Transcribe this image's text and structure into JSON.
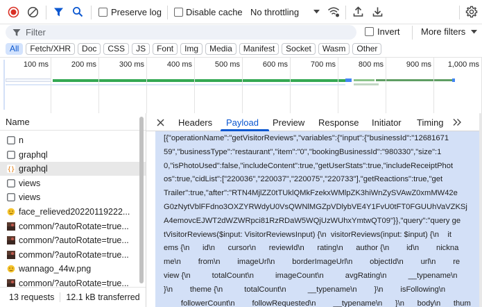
{
  "toolbar": {
    "preserve_log": "Preserve log",
    "disable_cache": "Disable cache",
    "throttling": "No throttling"
  },
  "filter": {
    "placeholder": "Filter",
    "invert": "Invert",
    "more_filters": "More filters"
  },
  "type_filters": [
    "All",
    "Fetch/XHR",
    "Doc",
    "CSS",
    "JS",
    "Font",
    "Img",
    "Media",
    "Manifest",
    "Socket",
    "Wasm",
    "Other"
  ],
  "timeline": {
    "ticks": [
      "100 ms",
      "200 ms",
      "300 ms",
      "400 ms",
      "500 ms",
      "600 ms",
      "700 ms",
      "800 ms",
      "900 ms",
      "1,000 ms"
    ]
  },
  "requests": {
    "header": "Name",
    "rows": [
      {
        "name": "n",
        "icon": "document-icon"
      },
      {
        "name": "graphql",
        "icon": "document-icon"
      },
      {
        "name": "graphql",
        "icon": "fetch-xhr-icon",
        "selected": true
      },
      {
        "name": "views",
        "icon": "document-icon"
      },
      {
        "name": "views",
        "icon": "document-icon"
      },
      {
        "name": "face_relieved20220119222...",
        "icon": "emoji-image-icon"
      },
      {
        "name": "common/?autoRotate=true...",
        "icon": "thumbnail-image-icon"
      },
      {
        "name": "common/?autoRotate=true...",
        "icon": "thumbnail-image-icon"
      },
      {
        "name": "common/?autoRotate=true...",
        "icon": "thumbnail-image-icon"
      },
      {
        "name": "wannago_44w.png",
        "icon": "emoji-image-icon"
      },
      {
        "name": "common/?autoRotate=true...",
        "icon": "thumbnail-image-icon"
      }
    ],
    "summary_requests": "13 requests",
    "summary_transferred": "12.1 kB transferred"
  },
  "details": {
    "tabs": [
      "Headers",
      "Payload",
      "Preview",
      "Response",
      "Initiator",
      "Timing"
    ],
    "active_tab": "Payload",
    "payload_lines": [
      "[{\"operationName\":\"getVisitorReviews\",\"variables\":{\"input\":{\"businessId\":\"12681671",
      "59\",\"businessType\":\"restaurant\",\"item\":\"0\",\"bookingBusinessId\":\"980330\",\"size\":1",
      "0,\"isPhotoUsed\":false,\"includeContent\":true,\"getUserStats\":true,\"includeReceiptPhot",
      "os\":true,\"cidList\":[\"220036\",\"220037\",\"220075\",\"220733\"],\"getReactions\":true,\"get",
      "Trailer\":true,\"after\":\"RTN4MjlZZ0tTUklQMkFzekxWMlpZK3hiWnZySVAwZ0xmMW42e",
      "G0zNytVblFFdno3OXZYRWdyU0VsQWNlMGZpVDlybVE4Y1FvU0tFT0FGUUhVaVZKSj",
      "A4emovcEJWT2dWZWRpci81RzRDaW5WQjUzWUhxYmtwQT09\"}},\"query\":\"query ge",
      "tVisitorReviews($input: VisitorReviewsInput) {\\n  visitorReviews(input: $input) {\\n    it",
      "ems {\\n      id\\n      cursor\\n      reviewId\\n      rating\\n      author {\\n        id\\n        nickna",
      "me\\n        from\\n        imageUrl\\n        borderImageUrl\\n        objectId\\n        url\\n        re",
      "view {\\n          totalCount\\n          imageCount\\n          avgRating\\n          __typename\\n",
      "}\\n        theme {\\n          totalCount\\n          __typename\\n        }\\n        isFollowing\\n",
      "        followerCount\\n        followRequested\\n        __typename\\n      }\\n      body\\n      thum"
    ]
  }
}
